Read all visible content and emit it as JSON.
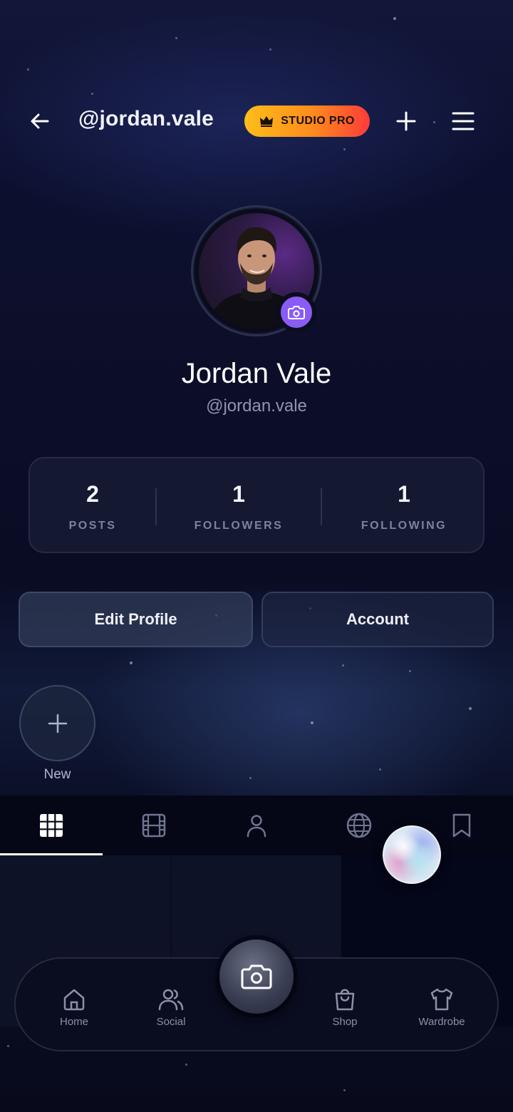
{
  "header": {
    "handle": "@jordan.vale",
    "badge": {
      "label": "STUDIO PRO",
      "icon": "crown-icon"
    }
  },
  "profile": {
    "name": "Jordan Vale",
    "handle": "@jordan.vale"
  },
  "stats": [
    {
      "value": "2",
      "label": "POSTS"
    },
    {
      "value": "1",
      "label": "FOLLOWERS"
    },
    {
      "value": "1",
      "label": "FOLLOWING"
    }
  ],
  "actions": {
    "edit_label": "Edit Profile",
    "account_label": "Account"
  },
  "highlights": {
    "new_label": "New"
  },
  "tabs": [
    {
      "icon": "grid-icon",
      "active": true
    },
    {
      "icon": "film-icon",
      "active": false
    },
    {
      "icon": "person-icon",
      "active": false
    },
    {
      "icon": "globe-icon",
      "active": false
    },
    {
      "icon": "bookmark-icon",
      "active": false
    }
  ],
  "bottom_nav": [
    {
      "label": "Home",
      "icon": "home-icon"
    },
    {
      "label": "Social",
      "icon": "users-icon"
    },
    {
      "label": "Shop",
      "icon": "shopping-bag-icon"
    },
    {
      "label": "Wardrobe",
      "icon": "shirt-icon"
    }
  ],
  "colors": {
    "accent_purple": "#8a5cf5",
    "badge_start": "#ffbe1a",
    "badge_end": "#ff3b3b"
  }
}
